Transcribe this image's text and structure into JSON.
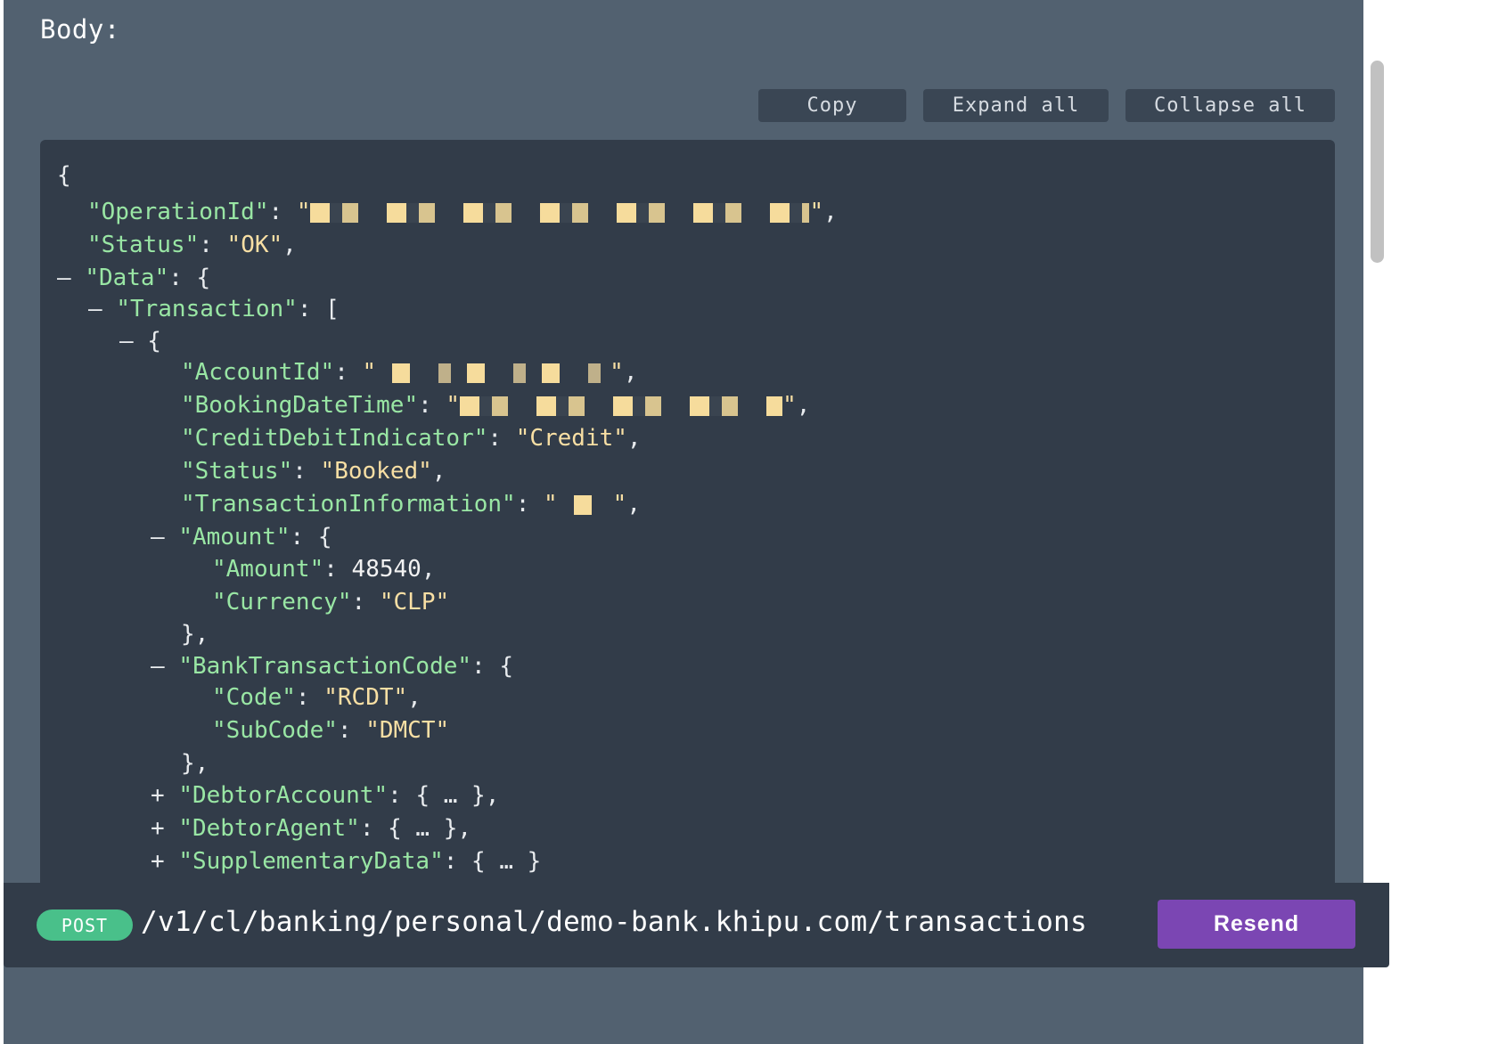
{
  "section": {
    "body_label": "Body:"
  },
  "toolbar": {
    "copy_label": "Copy",
    "expand_label": "Expand all",
    "collapse_label": "Collapse all"
  },
  "json_view": {
    "open_brace": "{",
    "operation_id_key": "\"OperationId\"",
    "status_key": "\"Status\"",
    "status_value": "\"OK\"",
    "data_key": "\"Data\"",
    "transaction_key": "\"Transaction\"",
    "account_id_key": "\"AccountId\"",
    "booking_key": "\"BookingDateTime\"",
    "cdi_key": "\"CreditDebitIndicator\"",
    "cdi_value": "\"Credit\"",
    "tx_status_key": "\"Status\"",
    "tx_status_value": "\"Booked\"",
    "txinfo_key": "\"TransactionInformation\"",
    "amount_obj_key": "\"Amount\"",
    "amount_key": "\"Amount\"",
    "amount_value": "48540",
    "currency_key": "\"Currency\"",
    "currency_value": "\"CLP\"",
    "btc_key": "\"BankTransactionCode\"",
    "code_key": "\"Code\"",
    "code_value": "\"RCDT\"",
    "subcode_key": "\"SubCode\"",
    "subcode_value": "\"DMCT\"",
    "debtor_account_key": "\"DebtorAccount\"",
    "debtor_agent_key": "\"DebtorAgent\"",
    "supplementary_key": "\"SupplementaryData\"",
    "collapsed": "{ … }",
    "toggle_expanded": "–",
    "toggle_collapsed": "+"
  },
  "request": {
    "method": "POST",
    "url": "/v1/cl/banking/personal/demo-bank.khipu.com/transactions",
    "resend_label": "Resend"
  }
}
